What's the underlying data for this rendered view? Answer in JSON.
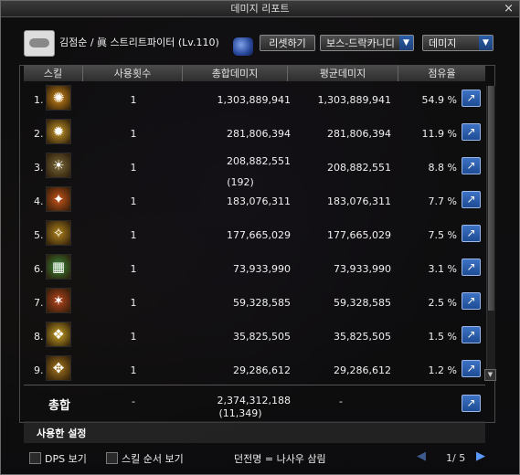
{
  "window": {
    "title": "데미지 리포트",
    "close_icon": "×"
  },
  "header": {
    "character": "김점순 / 眞 스트리트파이터 (Lv.110)",
    "reset_label": "리셋하기",
    "boss_select": "보스-드락카니디",
    "type_select": "데미지"
  },
  "columns": {
    "skill": "스킬",
    "uses": "사용횟수",
    "total": "총합데미지",
    "avg": "평균데미지",
    "share": "점유율"
  },
  "rows": [
    {
      "rank": "1.",
      "uses": "1",
      "total": "1,303,889,941",
      "avg": "1,303,889,941",
      "share": "54.9 %",
      "color": "#d08a1a"
    },
    {
      "rank": "2.",
      "uses": "1",
      "total": "281,806,394",
      "avg": "281,806,394",
      "share": "11.9 %",
      "color": "#c69a2a"
    },
    {
      "rank": "3.",
      "uses": "1",
      "total": "208,882,551",
      "sub": "(192)",
      "avg": "208,882,551",
      "share": "8.8 %",
      "color": "#7a6a3a"
    },
    {
      "rank": "4.",
      "uses": "1",
      "total": "183,076,311",
      "avg": "183,076,311",
      "share": "7.7 %",
      "color": "#c9541a"
    },
    {
      "rank": "5.",
      "uses": "1",
      "total": "177,665,029",
      "avg": "177,665,029",
      "share": "7.5 %",
      "color": "#b08420"
    },
    {
      "rank": "6.",
      "uses": "1",
      "total": "73,933,990",
      "avg": "73,933,990",
      "share": "3.1 %",
      "color": "#3a8a3a"
    },
    {
      "rank": "7.",
      "uses": "1",
      "total": "59,328,585",
      "avg": "59,328,585",
      "share": "2.5 %",
      "color": "#b8461e"
    },
    {
      "rank": "8.",
      "uses": "1",
      "total": "35,825,505",
      "avg": "35,825,505",
      "share": "1.5 %",
      "color": "#c7a227"
    },
    {
      "rank": "9.",
      "uses": "1",
      "total": "29,286,612",
      "avg": "29,286,612",
      "share": "1.2 %",
      "color": "#a8781e"
    }
  ],
  "totals": {
    "label": "총합",
    "uses": "-",
    "total": "2,374,312,188",
    "total_sub": "(11,349)",
    "avg": "-"
  },
  "used_settings": "사용한 설정",
  "footer": {
    "dps_label": "DPS 보기",
    "order_label": "스킬 순서 보기",
    "dungeon": "던전명 = 나사우 삼림",
    "page": "1/ 5",
    "prev_icon": "◀",
    "next_icon": "▶"
  }
}
